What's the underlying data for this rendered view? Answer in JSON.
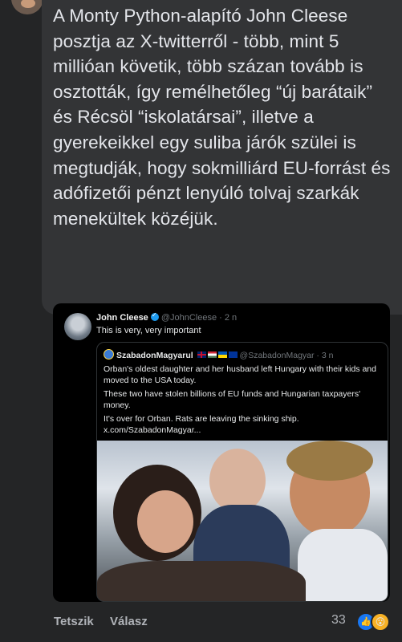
{
  "comment": {
    "text": "A Monty Python-alapító John Cleese posztja az X-twitterről - több, mint 5 millióan követik, több százan tovább is osztották, így remélhetőleg “új barátaik” és Récsöl “iskolatársai”, illetve a gyerekeikkel egy suliba járók szülei is megtudják, hogy sokmilliárd EU-forrást és adófizetői pénzt lenyúló tolvaj szarkák menekültek közéjük."
  },
  "tweet": {
    "author": "John Cleese",
    "handle": "@JohnCleese · 2 n",
    "text": "This is very, very important"
  },
  "quoted_tweet": {
    "author": "SzabadonMagyarul",
    "handle": "@SzabadonMagyar · 3 n",
    "paragraphs": [
      "Orban's oldest daughter and her husband left Hungary with their kids and moved to the USA today.",
      "These two have stolen billions of EU funds and Hungarian taxpayers' money.",
      "It's over for Orban. Rats are leaving the sinking ship. x.com/SzabadonMagyar..."
    ]
  },
  "actions": {
    "like_label": "Tetszik",
    "reply_label": "Válasz",
    "reaction_count": "33"
  },
  "colors": {
    "background": "#242526",
    "bubble": "#333436",
    "like_blue": "#1877f2",
    "verified_blue": "#1d9bf0"
  }
}
